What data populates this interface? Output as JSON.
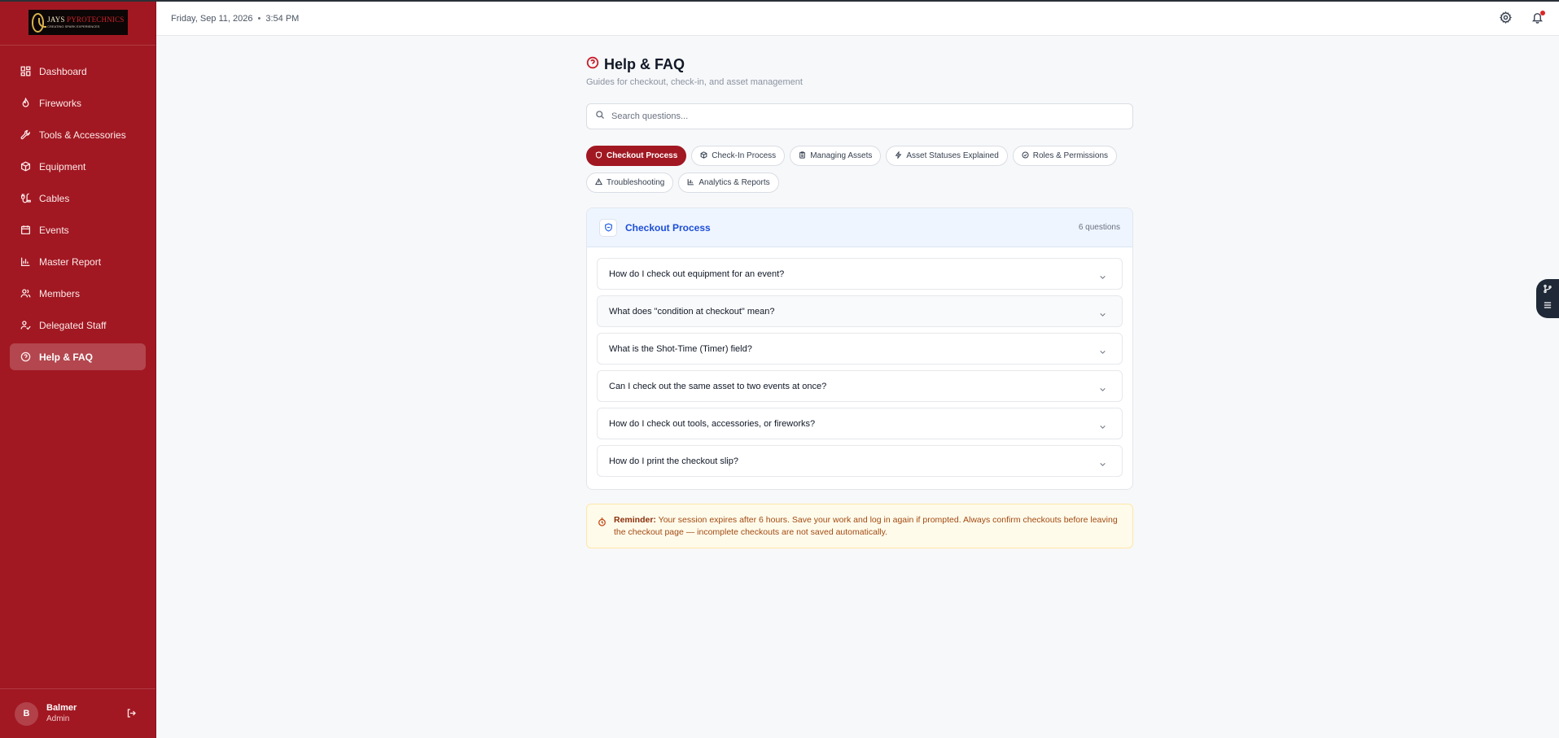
{
  "brand": {
    "logo_title_main": "JAYS ",
    "logo_title_accent": "PYROTECHNICS",
    "logo_tagline": "CREATING SPARK EXPERIENCES"
  },
  "sidebar": {
    "items": [
      {
        "label": "Dashboard",
        "icon": "dashboard-icon"
      },
      {
        "label": "Fireworks",
        "icon": "flame-icon"
      },
      {
        "label": "Tools & Accessories",
        "icon": "wrench-icon"
      },
      {
        "label": "Equipment",
        "icon": "box-icon"
      },
      {
        "label": "Cables",
        "icon": "cable-icon"
      },
      {
        "label": "Events",
        "icon": "calendar-icon"
      },
      {
        "label": "Master Report",
        "icon": "bar-chart-icon"
      },
      {
        "label": "Members",
        "icon": "users-icon"
      },
      {
        "label": "Delegated Staff",
        "icon": "user-check-icon"
      },
      {
        "label": "Help & FAQ",
        "icon": "help-circle-icon",
        "active": true
      }
    ],
    "user": {
      "initial": "B",
      "name": "Balmer",
      "role": "Admin"
    }
  },
  "topbar": {
    "date": "Friday, Sep 11, 2026",
    "separator": "•",
    "time": "3:54 PM"
  },
  "page": {
    "title": "Help & FAQ",
    "subtitle": "Guides for checkout, check-in, and asset management",
    "search_placeholder": "Search questions..."
  },
  "tabs": [
    {
      "label": "Checkout Process",
      "active": true
    },
    {
      "label": "Check-In Process"
    },
    {
      "label": "Managing Assets"
    },
    {
      "label": "Asset Statuses Explained"
    },
    {
      "label": "Roles & Permissions"
    },
    {
      "label": "Troubleshooting"
    },
    {
      "label": "Analytics & Reports"
    }
  ],
  "section": {
    "title": "Checkout Process",
    "count": "6 questions",
    "questions": [
      "How do I check out equipment for an event?",
      "What does \"condition at checkout\" mean?",
      "What is the Shot-Time (Timer) field?",
      "Can I check out the same asset to two events at once?",
      "How do I check out tools, accessories, or fireworks?",
      "How do I print the checkout slip?"
    ]
  },
  "reminder": {
    "label": "Reminder:",
    "text": " Your session expires after 6 hours. Save your work and log in again if prompted. Always confirm checkouts before leaving the checkout page — incomplete checkouts are not saved automatically."
  },
  "colors": {
    "sidebar": "#a11822",
    "accent": "#a11822",
    "section_title": "#1d4ed8",
    "reminder_bg": "#fffbeb"
  }
}
